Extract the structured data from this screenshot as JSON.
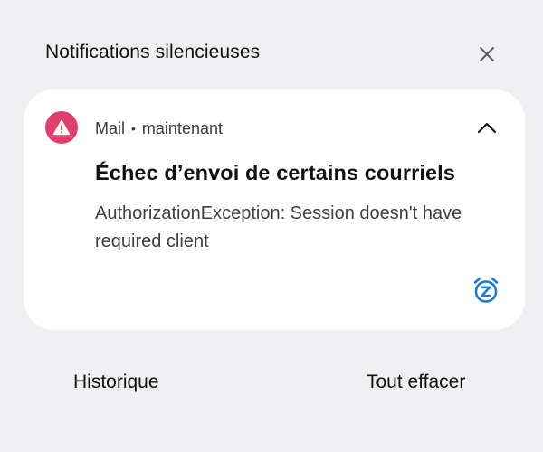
{
  "section": {
    "title": "Notifications silencieuses",
    "close_icon": "close-icon"
  },
  "notification": {
    "app_icon": "warning-triangle-icon",
    "app_icon_color": "#e03e6b",
    "app_name": "Mail",
    "separator": "•",
    "time": "maintenant",
    "collapse_icon": "chevron-up-icon",
    "title": "Échec d’envoi de certains courriels",
    "body": "AuthorizationException: Session doesn't have required client",
    "snooze_icon": "snooze-alarm-icon",
    "snooze_color": "#1f78d1"
  },
  "footer": {
    "history_label": "Historique",
    "clear_all_label": "Tout effacer"
  }
}
